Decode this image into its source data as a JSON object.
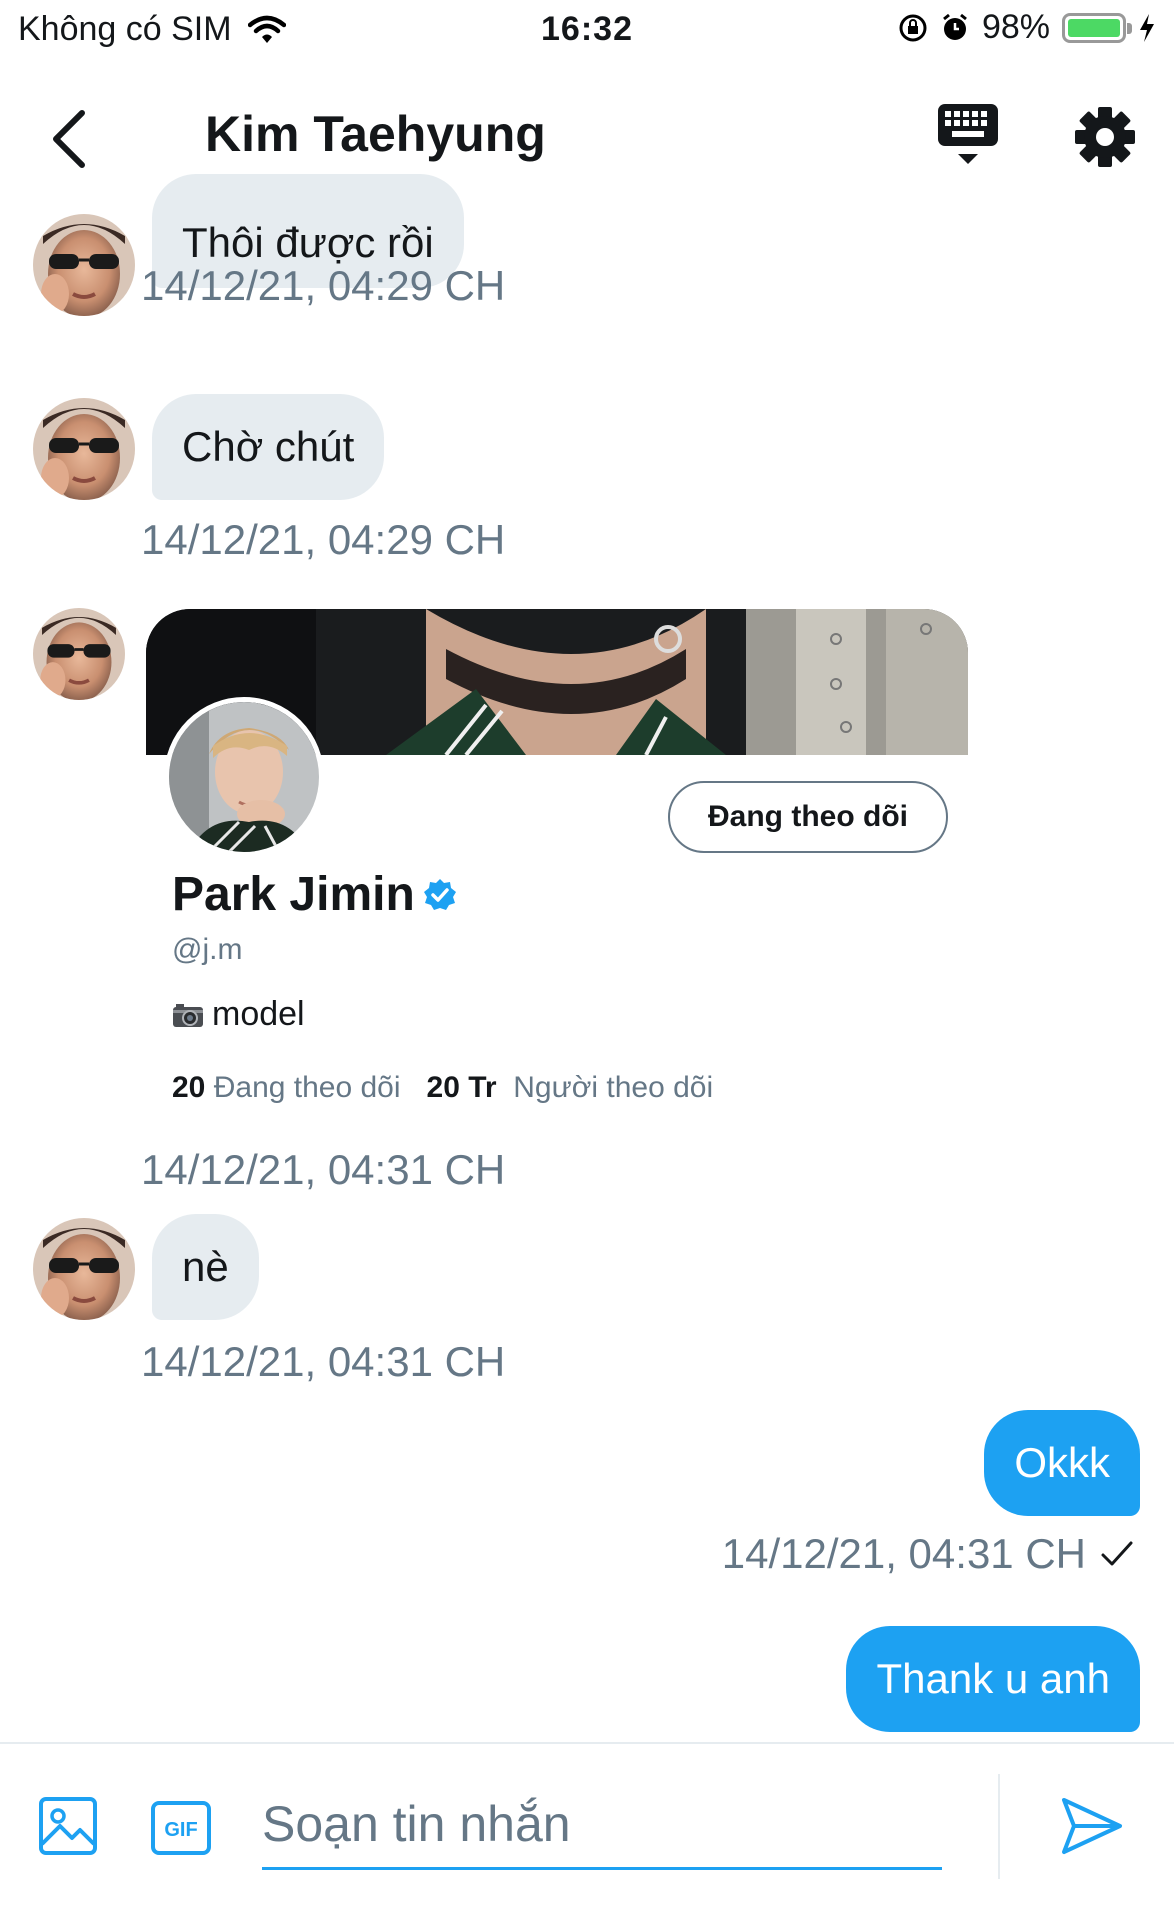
{
  "status_bar": {
    "carrier": "Không có SIM",
    "time": "16:32",
    "battery": "98%"
  },
  "header": {
    "title": "Kim Taehyung"
  },
  "messages": [
    {
      "direction": "in",
      "text": "Thôi được rồi",
      "timestamp": "14/12/21, 04:29 CH"
    },
    {
      "direction": "in",
      "text": "Chờ chút",
      "timestamp": "14/12/21, 04:29 CH"
    },
    {
      "direction": "in",
      "type": "profile_card",
      "timestamp": "14/12/21, 04:31 CH"
    },
    {
      "direction": "in",
      "text": "nè",
      "timestamp": "14/12/21, 04:31 CH"
    },
    {
      "direction": "out",
      "text": "Okkk",
      "timestamp": "14/12/21, 04:31 CH"
    },
    {
      "direction": "out",
      "text": "Thank u anh"
    }
  ],
  "profile_card": {
    "name": "Park Jimin",
    "handle": "@j.m",
    "bio": "model",
    "follow_button": "Đang theo dõi",
    "following_count": "20",
    "following_label": "Đang theo dõi",
    "followers_count": "20 Tr",
    "followers_label": "Người theo dõi"
  },
  "composer": {
    "placeholder": "Soạn tin nhắn"
  },
  "colors": {
    "accent": "#1da1f2",
    "incoming_bubble": "#e6ecf0",
    "secondary_text": "#657786",
    "battery": "#4cd964"
  }
}
